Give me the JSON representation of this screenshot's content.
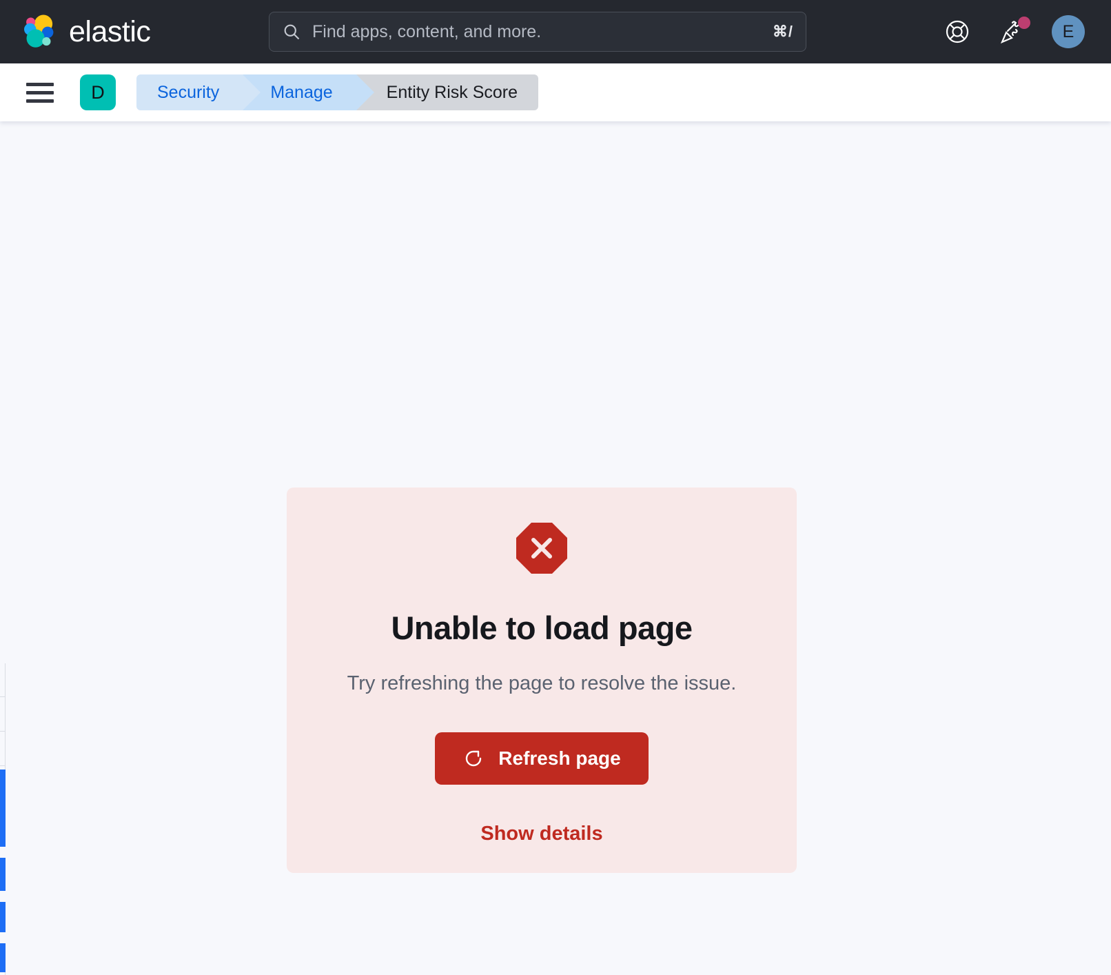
{
  "header": {
    "logo_icon": "elastic-logo-icon",
    "brand": "elastic",
    "logo_colors": {
      "yellow": "#FEC514",
      "teal": "#00BFB3",
      "pink": "#EE4C8B",
      "blue_light": "#1BA9F5",
      "blue_dark": "#0B64DD",
      "green": "#7DE2D1"
    },
    "search": {
      "icon": "search-icon",
      "placeholder": "Find apps, content, and more.",
      "value": "",
      "shortcut": "⌘/"
    },
    "actions": [
      {
        "name": "help-icon",
        "label": "Help"
      },
      {
        "name": "news-icon",
        "label": "News",
        "has_notification": true
      }
    ],
    "notification_color": "#BD3E70",
    "avatar": {
      "initial": "E",
      "color": "#6092C0"
    },
    "background": "#25282F"
  },
  "breadcrumb_bar": {
    "menu_icon": "hamburger-menu-icon",
    "space_badge": "D",
    "space_badge_color": "#00BFB3",
    "crumbs": [
      {
        "label": "Security",
        "active": false
      },
      {
        "label": "Manage",
        "active": false
      },
      {
        "label": "Entity Risk Score",
        "active": true
      }
    ]
  },
  "main": {
    "background": "#F7F8FC",
    "error": {
      "icon": "error-octagon-icon",
      "icon_color": "#BF2A20",
      "panel_color": "#F8E8E8",
      "title": "Unable to load page",
      "subtitle": "Try refreshing the page to resolve the issue.",
      "refresh_button": {
        "icon": "refresh-icon",
        "label": "Refresh page",
        "color": "#BF2A20"
      },
      "details_link": "Show details"
    }
  }
}
